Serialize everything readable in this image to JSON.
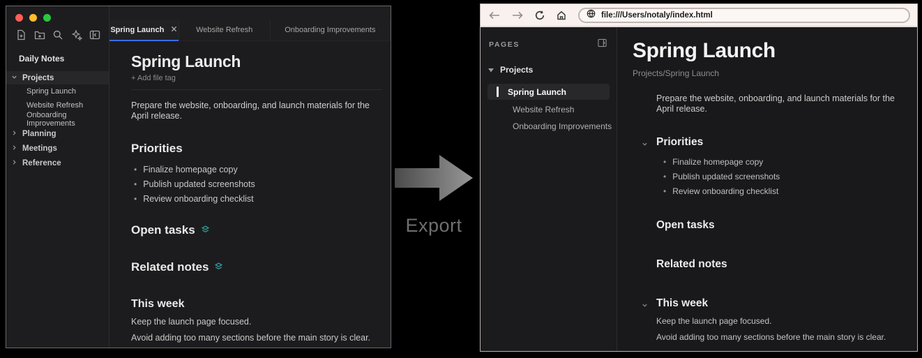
{
  "export_arrow": {
    "label": "Export"
  },
  "left_window": {
    "traffic_lights": [
      "close",
      "minimize",
      "maximize"
    ],
    "nav_icons": [
      "new-note",
      "new-folder",
      "search",
      "command-palette",
      "collapse-sidebar"
    ],
    "sidebar": {
      "title": "Daily Notes",
      "project_group": "Projects",
      "project_children": [
        "Spring Launch",
        "Website Refresh",
        "Onboarding Improvements"
      ],
      "collapsed_groups": [
        "Planning",
        "Meetings",
        "Reference"
      ]
    },
    "tabs": [
      {
        "label": "Spring Launch",
        "active": true
      },
      {
        "label": "Website Refresh",
        "active": false
      },
      {
        "label": "Onboarding Improvements",
        "active": false
      }
    ],
    "note": {
      "title": "Spring Launch",
      "add_tag_label": "+ Add file tag",
      "intro": "Prepare the website, onboarding, and launch materials for the April release.",
      "priorities_heading": "Priorities",
      "priorities": [
        "Finalize homepage copy",
        "Publish updated screenshots",
        "Review onboarding checklist"
      ],
      "open_tasks_heading": "Open tasks",
      "related_notes_heading": "Related notes",
      "this_week_heading": "This week",
      "this_week_lines": [
        "Keep the launch page focused.",
        "Avoid adding too many sections before the main story is clear."
      ]
    }
  },
  "right_window": {
    "toolbar": {
      "url": "file:///Users/notaly/index.html"
    },
    "sidebar": {
      "header": "PAGES",
      "group_label": "Projects",
      "items": [
        {
          "label": "Spring Launch",
          "active": true
        },
        {
          "label": "Website Refresh",
          "active": false
        },
        {
          "label": "Onboarding Improvements",
          "active": false
        }
      ]
    },
    "page": {
      "title": "Spring Launch",
      "breadcrumb": "Projects/Spring Launch",
      "intro": "Prepare the website, onboarding, and launch materials for the April release.",
      "priorities_heading": "Priorities",
      "priorities": [
        "Finalize homepage copy",
        "Publish updated screenshots",
        "Review onboarding checklist"
      ],
      "open_tasks_heading": "Open tasks",
      "related_notes_heading": "Related notes",
      "this_week_heading": "This week",
      "this_week_lines": [
        "Keep the launch page focused.",
        "Avoid adding too many sections before the main story is clear."
      ]
    }
  },
  "colors": {
    "accent_blue": "#3b6ef5",
    "teal_icon": "#2fa0a0",
    "traffic_red": "#ff5f57",
    "traffic_yellow": "#febc2e",
    "traffic_green": "#28c840",
    "toolbar_bg": "#f9f1ee"
  }
}
